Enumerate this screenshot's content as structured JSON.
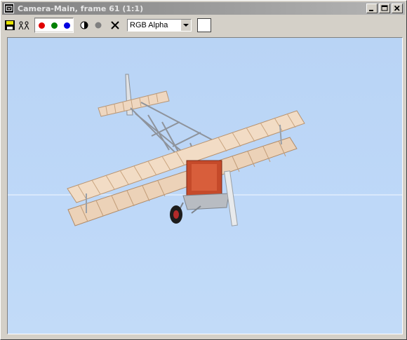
{
  "window": {
    "title": "Camera-Main, frame 61 (1:1)",
    "icon": "max-icon",
    "controls": [
      "minimize-icon",
      "maximize-icon",
      "close-icon"
    ]
  },
  "toolbar": {
    "save_icon": "floppy-disk-icon",
    "clone_icon": "clone-window-icon",
    "channels": [
      {
        "name": "red",
        "color": "#e00000"
      },
      {
        "name": "green",
        "color": "#008000"
      },
      {
        "name": "blue",
        "color": "#0000e0"
      }
    ],
    "mono_icon": "monochrome-icon",
    "alpha_icon": "alpha-circle-icon",
    "clear_icon": "clear-x-icon",
    "display_select": "RGB Alpha",
    "swatch_color": "#ffffff"
  },
  "viewport": {
    "background": "#bdd7f6",
    "subject": "biplane"
  }
}
